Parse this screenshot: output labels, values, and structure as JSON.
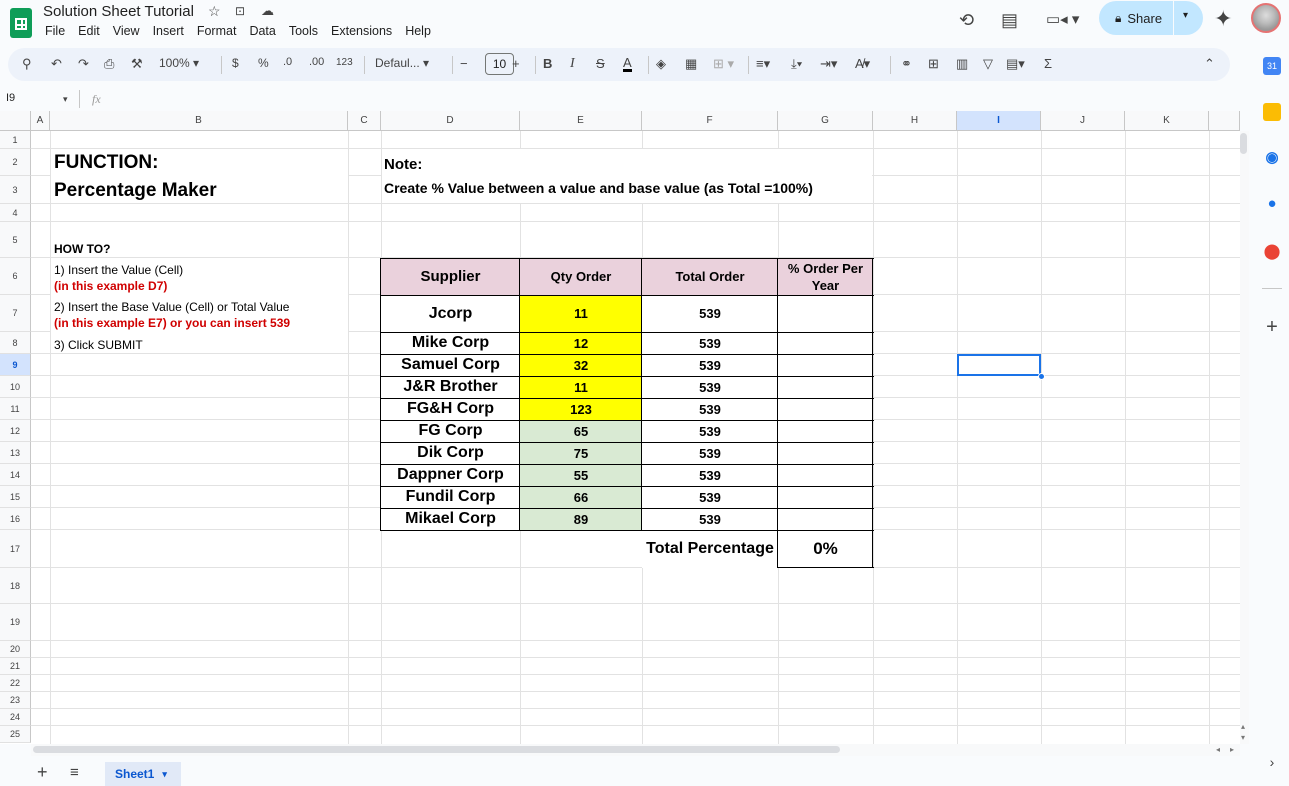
{
  "app": {
    "title": "Solution Sheet Tutorial",
    "menu": [
      "File",
      "Edit",
      "View",
      "Insert",
      "Format",
      "Data",
      "Tools",
      "Extensions",
      "Help"
    ],
    "share_label": "Share",
    "accent": "#c2e7ff",
    "brand": "#0f9d58"
  },
  "toolbar": {
    "zoom": "100%",
    "currency": "$",
    "percent": "%",
    "dec_decrease": ".0",
    "dec_increase": ".00",
    "number_format": "123",
    "font": "Defaul...",
    "font_size": "10",
    "minus": "−",
    "plus": "+",
    "bold": "B",
    "italic": "I",
    "strike": "S",
    "text_color": "A",
    "sum": "Σ"
  },
  "formula_bar": {
    "cell_ref": "I9",
    "fx": "fx"
  },
  "columns": [
    "A",
    "B",
    "C",
    "D",
    "E",
    "F",
    "G",
    "H",
    "I",
    "J",
    "K"
  ],
  "rows": [
    "1",
    "2",
    "3",
    "4",
    "5",
    "6",
    "7",
    "8",
    "9",
    "10",
    "11",
    "12",
    "13",
    "14",
    "15",
    "16",
    "17",
    "18",
    "19",
    "20",
    "21",
    "22",
    "23",
    "24",
    "25"
  ],
  "selected": {
    "column": "I",
    "row": "9"
  },
  "content": {
    "function_title_1": "FUNCTION:",
    "function_title_2": "Percentage Maker",
    "note_title": "Note:",
    "note_text": "Create % Value between a value and base value (as Total =100%)",
    "howto_title": "HOW TO?",
    "step1": "1) Insert the Value (Cell)",
    "step1_example": "(in this example D7)",
    "step2": "2) Insert the Base Value (Cell) or Total Value",
    "step2_example": "(in this example E7) or you can insert 539",
    "step3": "3) Click SUBMIT",
    "example_color": "#d00000"
  },
  "table": {
    "headers": [
      "Supplier",
      "Qty Order",
      "Total Order",
      "% Order Per Year"
    ],
    "rows": [
      {
        "supplier": "Jcorp",
        "qty": "11",
        "total": "539",
        "pct": ""
      },
      {
        "supplier": "Mike Corp",
        "qty": "12",
        "total": "539",
        "pct": ""
      },
      {
        "supplier": "Samuel Corp",
        "qty": "32",
        "total": "539",
        "pct": ""
      },
      {
        "supplier": "J&R Brother",
        "qty": "11",
        "total": "539",
        "pct": ""
      },
      {
        "supplier": "FG&H Corp",
        "qty": "123",
        "total": "539",
        "pct": ""
      },
      {
        "supplier": "FG Corp",
        "qty": "65",
        "total": "539",
        "pct": ""
      },
      {
        "supplier": "Dik Corp",
        "qty": "75",
        "total": "539",
        "pct": ""
      },
      {
        "supplier": "Dappner Corp",
        "qty": "55",
        "total": "539",
        "pct": ""
      },
      {
        "supplier": "Fundil Corp",
        "qty": "66",
        "total": "539",
        "pct": ""
      },
      {
        "supplier": "Mikael Corp",
        "qty": "89",
        "total": "539",
        "pct": ""
      }
    ],
    "total_label": "Total Percentage",
    "total_value": "0%",
    "header_bg": "#ead1dc",
    "yellow": "#ffff00",
    "green": "#d9ead3"
  },
  "sheets": {
    "active": "Sheet1"
  }
}
